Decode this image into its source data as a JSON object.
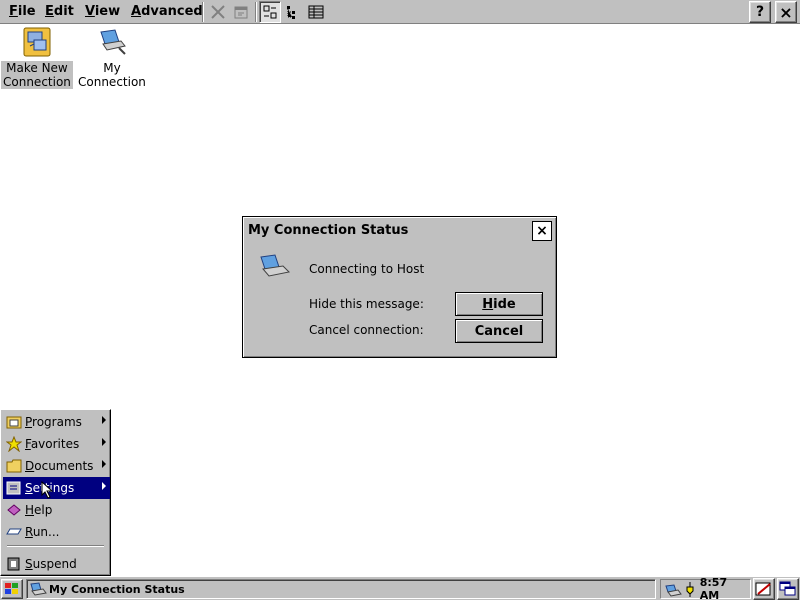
{
  "menubar": {
    "items": [
      {
        "first": "F",
        "rest": "ile"
      },
      {
        "first": "E",
        "rest": "dit"
      },
      {
        "first": "V",
        "rest": "iew"
      },
      {
        "first": "A",
        "rest": "dvanced"
      }
    ],
    "help_label": "?",
    "close_label": "×"
  },
  "desktop": {
    "icons": [
      {
        "label_line1": "Make New",
        "label_line2": "Connection",
        "icon": "make-new-connection-icon"
      },
      {
        "label_line1": "My",
        "label_line2": "Connection",
        "icon": "my-connection-icon"
      }
    ]
  },
  "dialog": {
    "title": "My Connection Status",
    "close_label": "×",
    "status_text": "Connecting to Host",
    "hide_prompt": "Hide this message:",
    "cancel_prompt": "Cancel connection:",
    "hide_button": {
      "first": "H",
      "rest": "ide"
    },
    "cancel_button": "Cancel"
  },
  "start_menu": {
    "items": [
      {
        "first": "P",
        "rest": "rograms",
        "icon": "programs-icon",
        "submenu": true
      },
      {
        "first": "F",
        "rest": "avorites",
        "icon": "favorites-icon",
        "submenu": true
      },
      {
        "first": "D",
        "rest": "ocuments",
        "icon": "documents-icon",
        "submenu": true
      },
      {
        "first": "S",
        "rest": "ettings",
        "icon": "settings-icon",
        "submenu": true,
        "active": true
      },
      {
        "first": "H",
        "rest": "elp",
        "icon": "help-icon",
        "submenu": false
      },
      {
        "first": "R",
        "rest": "un...",
        "icon": "run-icon",
        "submenu": false
      },
      {
        "first": "S",
        "rest": "uspend",
        "icon": "suspend-icon",
        "submenu": false
      }
    ]
  },
  "taskbar": {
    "task_label": "My Connection Status",
    "clock": "8:57 AM"
  },
  "colors": {
    "face": "#c0c0c0",
    "highlight": "#000080",
    "desktop": "#ffffff"
  }
}
